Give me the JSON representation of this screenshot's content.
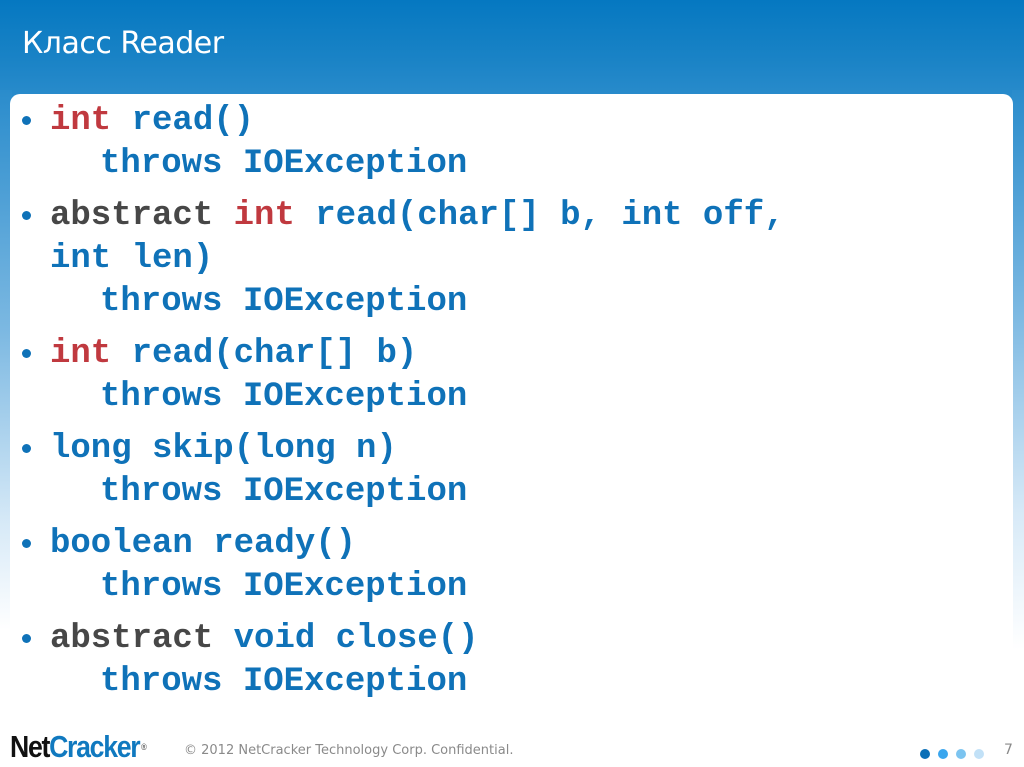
{
  "slide": {
    "title": "Класс Reader",
    "colors": {
      "header_blue": "#0578c1",
      "keyword_red": "#c0393f",
      "keyword_gray": "#474747",
      "code_blue": "#0f72b8"
    },
    "bullets": [
      {
        "lines": [
          [
            {
              "text": "int",
              "style": "red"
            },
            {
              "text": " read()",
              "style": "blue"
            }
          ],
          [
            {
              "text": "throws IOException",
              "style": "blue",
              "indent": true
            }
          ]
        ]
      },
      {
        "lines": [
          [
            {
              "text": "abstract",
              "style": "gray"
            },
            {
              "text": " ",
              "style": "blue"
            },
            {
              "text": "int",
              "style": "red"
            },
            {
              "text": " read(char[] b, int off,",
              "style": "blue"
            }
          ],
          [
            {
              "text": "int len)",
              "style": "blue"
            }
          ],
          [
            {
              "text": "throws IOException",
              "style": "blue",
              "indent": true
            }
          ]
        ]
      },
      {
        "lines": [
          [
            {
              "text": "int",
              "style": "red"
            },
            {
              "text": " read(char[] b)",
              "style": "blue"
            }
          ],
          [
            {
              "text": "throws IOException",
              "style": "blue",
              "indent": true
            }
          ]
        ]
      },
      {
        "lines": [
          [
            {
              "text": "long skip(long n)",
              "style": "blue"
            }
          ],
          [
            {
              "text": "throws IOException",
              "style": "blue",
              "indent": true
            }
          ]
        ]
      },
      {
        "lines": [
          [
            {
              "text": "boolean ready()",
              "style": "blue"
            }
          ],
          [
            {
              "text": "throws IOException",
              "style": "blue",
              "indent": true
            }
          ]
        ]
      },
      {
        "lines": [
          [
            {
              "text": "abstract",
              "style": "gray"
            },
            {
              "text": " void close()",
              "style": "blue"
            }
          ],
          [
            {
              "text": "throws IOException",
              "style": "blue",
              "indent": true
            }
          ]
        ]
      }
    ]
  },
  "footer": {
    "logo_part1": "Net",
    "logo_part2": "Cracker",
    "logo_mark": "®",
    "copyright": "© 2012 NetCracker Technology Corp. Confidential.",
    "page_number": "7",
    "pager_dots": [
      {
        "color": "#0a6fb7"
      },
      {
        "color": "#3aa6ee"
      },
      {
        "color": "#7cc4f0"
      },
      {
        "color": "#c2e1f7"
      }
    ]
  }
}
